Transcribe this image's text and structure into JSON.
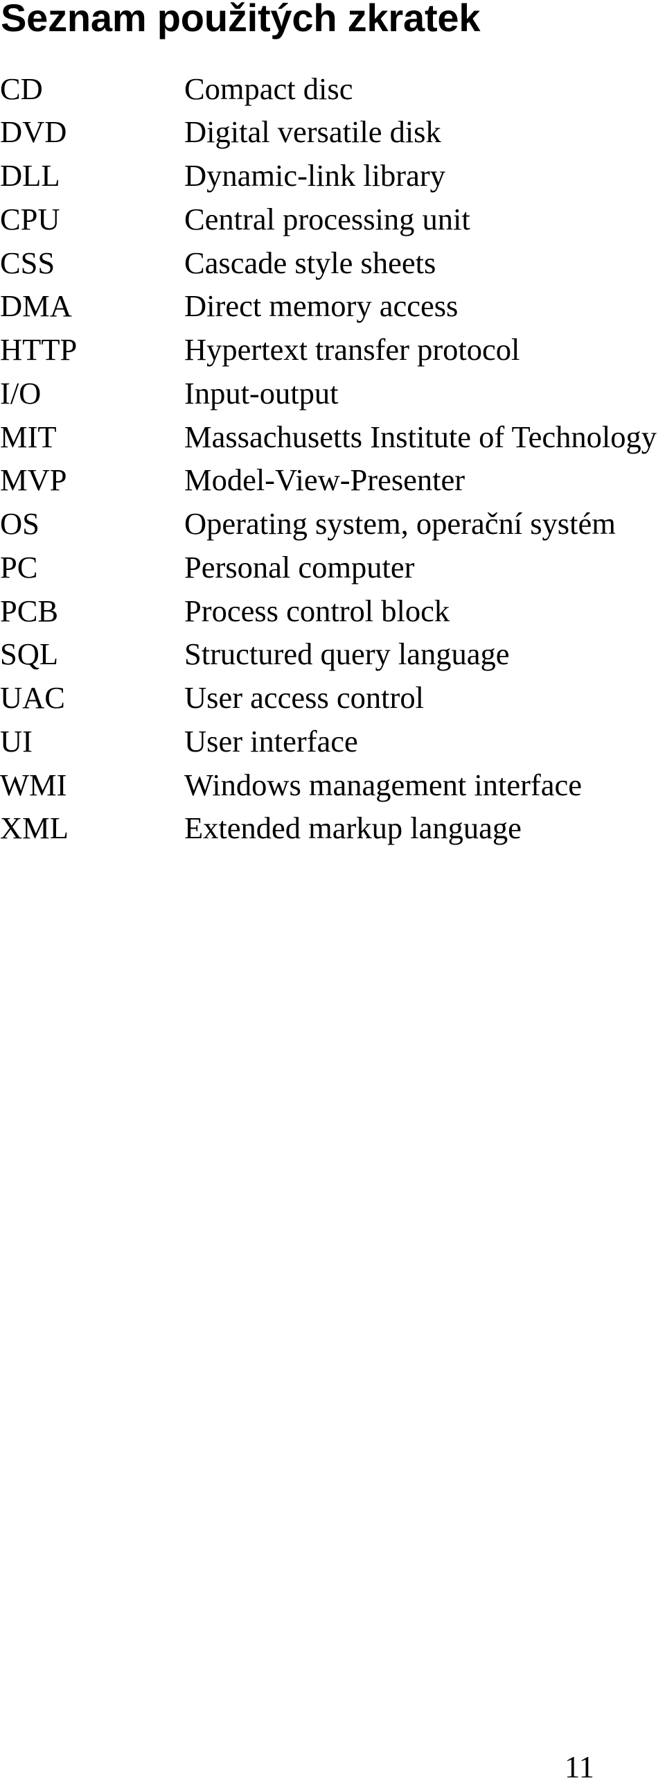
{
  "page": {
    "title": "Seznam použitých zkratek",
    "page_number": "11"
  },
  "abbreviations": [
    {
      "term": "CD",
      "definition": "Compact disc"
    },
    {
      "term": "DVD",
      "definition": "Digital versatile disk"
    },
    {
      "term": "DLL",
      "definition": "Dynamic-link library"
    },
    {
      "term": "CPU",
      "definition": "Central processing unit"
    },
    {
      "term": "CSS",
      "definition": "Cascade style sheets"
    },
    {
      "term": "DMA",
      "definition": "Direct memory access"
    },
    {
      "term": "HTTP",
      "definition": "Hypertext transfer protocol"
    },
    {
      "term": "I/O",
      "definition": "Input-output"
    },
    {
      "term": "MIT",
      "definition": "Massachusetts Institute of Technology"
    },
    {
      "term": "MVP",
      "definition": "Model-View-Presenter"
    },
    {
      "term": "OS",
      "definition": "Operating system, operační systém"
    },
    {
      "term": "PC",
      "definition": "Personal computer"
    },
    {
      "term": "PCB",
      "definition": "Process control block"
    },
    {
      "term": "SQL",
      "definition": "Structured query language"
    },
    {
      "term": "UAC",
      "definition": "User access control"
    },
    {
      "term": "UI",
      "definition": "User interface"
    },
    {
      "term": "WMI",
      "definition": "Windows management interface"
    },
    {
      "term": "XML",
      "definition": "Extended markup language"
    }
  ]
}
